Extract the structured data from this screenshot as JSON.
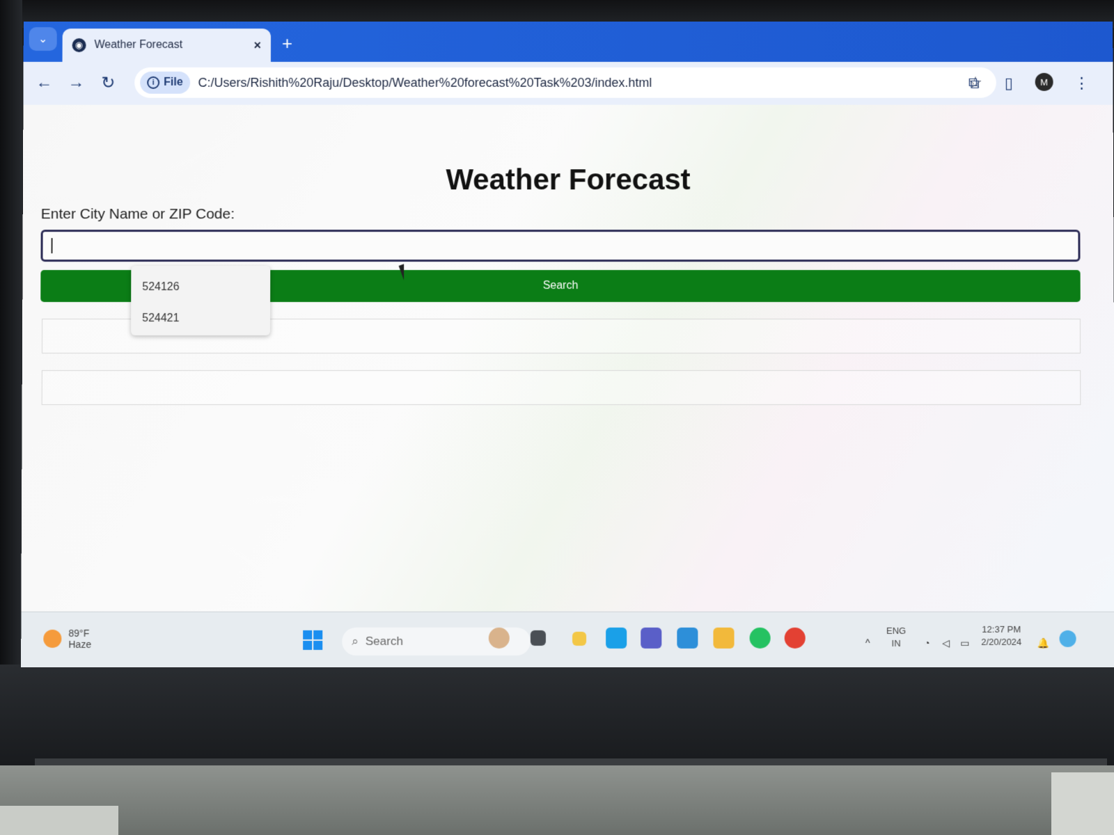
{
  "browser": {
    "tab_title": "Weather Forecast",
    "tab_close": "×",
    "new_tab": "+",
    "file_chip": "File",
    "url": "C:/Users/Rishith%20Raju/Desktop/Weather%20forecast%20Task%203/index.html",
    "profile_initial": "M"
  },
  "page": {
    "title": "Weather Forecast",
    "input_label": "Enter City Name or ZIP Code:",
    "input_value": "",
    "search_button": "Search",
    "suggestions": [
      "524126",
      "524421"
    ]
  },
  "taskbar": {
    "weather_temp": "89°F",
    "weather_condition": "Haze",
    "search_placeholder": "Search",
    "language": "ENG",
    "region": "IN",
    "time": "12:37 PM",
    "date": "2/20/2024"
  },
  "colors": {
    "search_button": "#0b7d16",
    "tab_bar": "#1f5fd6",
    "input_border": "#2b2b55"
  }
}
